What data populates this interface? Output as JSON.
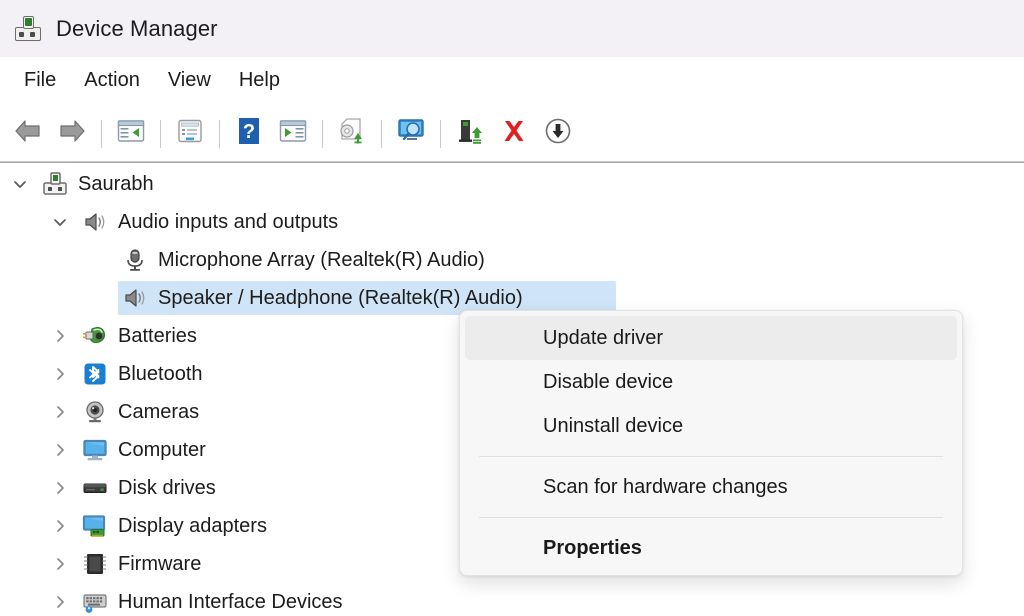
{
  "window": {
    "title": "Device Manager",
    "title_icon": "device-manager-icon"
  },
  "menubar": {
    "items": [
      {
        "label": "File"
      },
      {
        "label": "Action"
      },
      {
        "label": "View"
      },
      {
        "label": "Help"
      }
    ]
  },
  "toolbar": {
    "buttons": [
      {
        "name": "back-button",
        "icon": "back-arrow-icon"
      },
      {
        "name": "forward-button",
        "icon": "forward-arrow-icon"
      },
      {
        "name": "show-hide-console-tree-button",
        "icon": "console-tree-icon"
      },
      {
        "name": "properties-button",
        "icon": "properties-page-icon"
      },
      {
        "name": "help-button",
        "icon": "question-mark-icon"
      },
      {
        "name": "show-hide-action-pane-button",
        "icon": "action-pane-icon"
      },
      {
        "name": "update-driver-button",
        "icon": "update-driver-icon"
      },
      {
        "name": "scan-for-hardware-changes-button",
        "icon": "scan-monitor-icon"
      },
      {
        "name": "install-legacy-hardware-button",
        "icon": "install-device-icon"
      },
      {
        "name": "uninstall-device-button",
        "icon": "red-x-icon"
      },
      {
        "name": "disable-device-button",
        "icon": "down-arrow-circle-icon"
      }
    ]
  },
  "tree": {
    "rows": [
      {
        "label": "Saurabh",
        "icon": "computer-root-icon",
        "depth": 0,
        "expander": "expanded",
        "selected": false
      },
      {
        "label": "Audio inputs and outputs",
        "icon": "speaker-icon",
        "depth": 1,
        "expander": "expanded",
        "selected": false
      },
      {
        "label": "Microphone Array (Realtek(R) Audio)",
        "icon": "microphone-icon",
        "depth": 2,
        "expander": "none",
        "selected": false
      },
      {
        "label": "Speaker / Headphone (Realtek(R) Audio)",
        "icon": "speaker-icon",
        "depth": 2,
        "expander": "none",
        "selected": true
      },
      {
        "label": "Batteries",
        "icon": "battery-plug-icon",
        "depth": 1,
        "expander": "collapsed",
        "selected": false
      },
      {
        "label": "Bluetooth",
        "icon": "bluetooth-icon",
        "depth": 1,
        "expander": "collapsed",
        "selected": false
      },
      {
        "label": "Cameras",
        "icon": "camera-icon",
        "depth": 1,
        "expander": "collapsed",
        "selected": false
      },
      {
        "label": "Computer",
        "icon": "monitor-icon",
        "depth": 1,
        "expander": "collapsed",
        "selected": false
      },
      {
        "label": "Disk drives",
        "icon": "disk-drive-icon",
        "depth": 1,
        "expander": "collapsed",
        "selected": false
      },
      {
        "label": "Display adapters",
        "icon": "display-adapter-icon",
        "depth": 1,
        "expander": "collapsed",
        "selected": false
      },
      {
        "label": "Firmware",
        "icon": "firmware-chip-icon",
        "depth": 1,
        "expander": "collapsed",
        "selected": false
      },
      {
        "label": "Human Interface Devices",
        "icon": "keyboard-hid-icon",
        "depth": 1,
        "expander": "collapsed",
        "selected": false
      }
    ]
  },
  "context_menu": {
    "items": [
      {
        "label": "Update driver",
        "kind": "item",
        "hovered": true,
        "bold": false
      },
      {
        "label": "Disable device",
        "kind": "item",
        "hovered": false,
        "bold": false
      },
      {
        "label": "Uninstall device",
        "kind": "item",
        "hovered": false,
        "bold": false
      },
      {
        "kind": "separator"
      },
      {
        "label": "Scan for hardware changes",
        "kind": "item",
        "hovered": false,
        "bold": false
      },
      {
        "kind": "separator"
      },
      {
        "label": "Properties",
        "kind": "item",
        "hovered": false,
        "bold": true
      }
    ]
  },
  "colors": {
    "titlebar_bg": "#f3f1f6",
    "selection_bg": "#cfe4f7",
    "menu_bg": "#f7f7f7",
    "menu_hover_bg": "#ececec",
    "text": "#1c1c1c",
    "accent_red": "#e02020",
    "accent_green": "#3f9c35",
    "accent_blue": "#1a7fd4"
  }
}
